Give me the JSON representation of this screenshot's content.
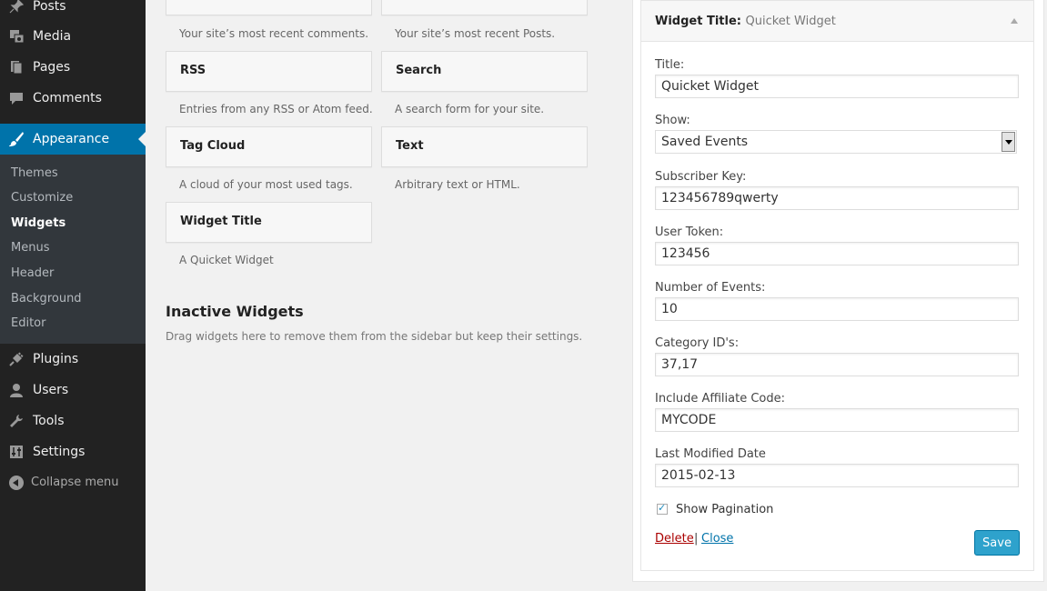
{
  "sidebar": {
    "menu": [
      {
        "id": "posts",
        "label": "Posts",
        "icon": "pin-icon"
      },
      {
        "id": "media",
        "label": "Media",
        "icon": "media-icon"
      },
      {
        "id": "pages",
        "label": "Pages",
        "icon": "pages-icon"
      },
      {
        "id": "comments",
        "label": "Comments",
        "icon": "comment-icon"
      },
      {
        "id": "appearance",
        "label": "Appearance",
        "icon": "brush-icon"
      }
    ],
    "submenu": [
      "Themes",
      "Customize",
      "Widgets",
      "Menus",
      "Header",
      "Background",
      "Editor"
    ],
    "menu_bottom": [
      {
        "id": "plugins",
        "label": "Plugins",
        "icon": "plugin-icon"
      },
      {
        "id": "users",
        "label": "Users",
        "icon": "user-icon"
      },
      {
        "id": "tools",
        "label": "Tools",
        "icon": "wrench-icon"
      },
      {
        "id": "settings",
        "label": "Settings",
        "icon": "settings-icon"
      }
    ],
    "collapse_label": "Collapse menu",
    "active_color": "#0073aa"
  },
  "widgets": {
    "recent_comments_desc": "Your site’s most recent comments.",
    "recent_posts_desc": "Your site’s most recent Posts.",
    "items": [
      {
        "title": "RSS",
        "desc": "Entries from any RSS or Atom feed."
      },
      {
        "title": "Search",
        "desc": "A search form for your site."
      },
      {
        "title": "Tag Cloud",
        "desc": "A cloud of your most used tags."
      },
      {
        "title": "Text",
        "desc": "Arbitrary text or HTML."
      },
      {
        "title": "Widget Title",
        "desc": "A Quicket Widget"
      }
    ],
    "inactive_title": "Inactive Widgets",
    "inactive_desc": "Drag widgets here to remove them from the sidebar but keep their settings."
  },
  "editor": {
    "header_label": "Widget Title:",
    "header_name": "Quicket Widget",
    "fields": {
      "title_label": "Title:",
      "title_value": "Quicket Widget",
      "show_label": "Show:",
      "show_value": "Saved Events",
      "subscriber_label": "Subscriber Key:",
      "subscriber_value": "123456789qwerty",
      "token_label": "User Token:",
      "token_value": "123456",
      "num_label": "Number of Events:",
      "num_value": "10",
      "category_label": "Category ID's:",
      "category_value": "37,17",
      "affiliate_label": "Include Affiliate Code:",
      "affiliate_value": "MYCODE",
      "modified_label": "Last Modified Date",
      "modified_value": "2015-02-13",
      "pagination_label": "Show Pagination"
    },
    "delete_label": "Delete",
    "separator": "|",
    "close_label": "Close",
    "save_label": "Save",
    "save_color": "#2ea2cc"
  }
}
